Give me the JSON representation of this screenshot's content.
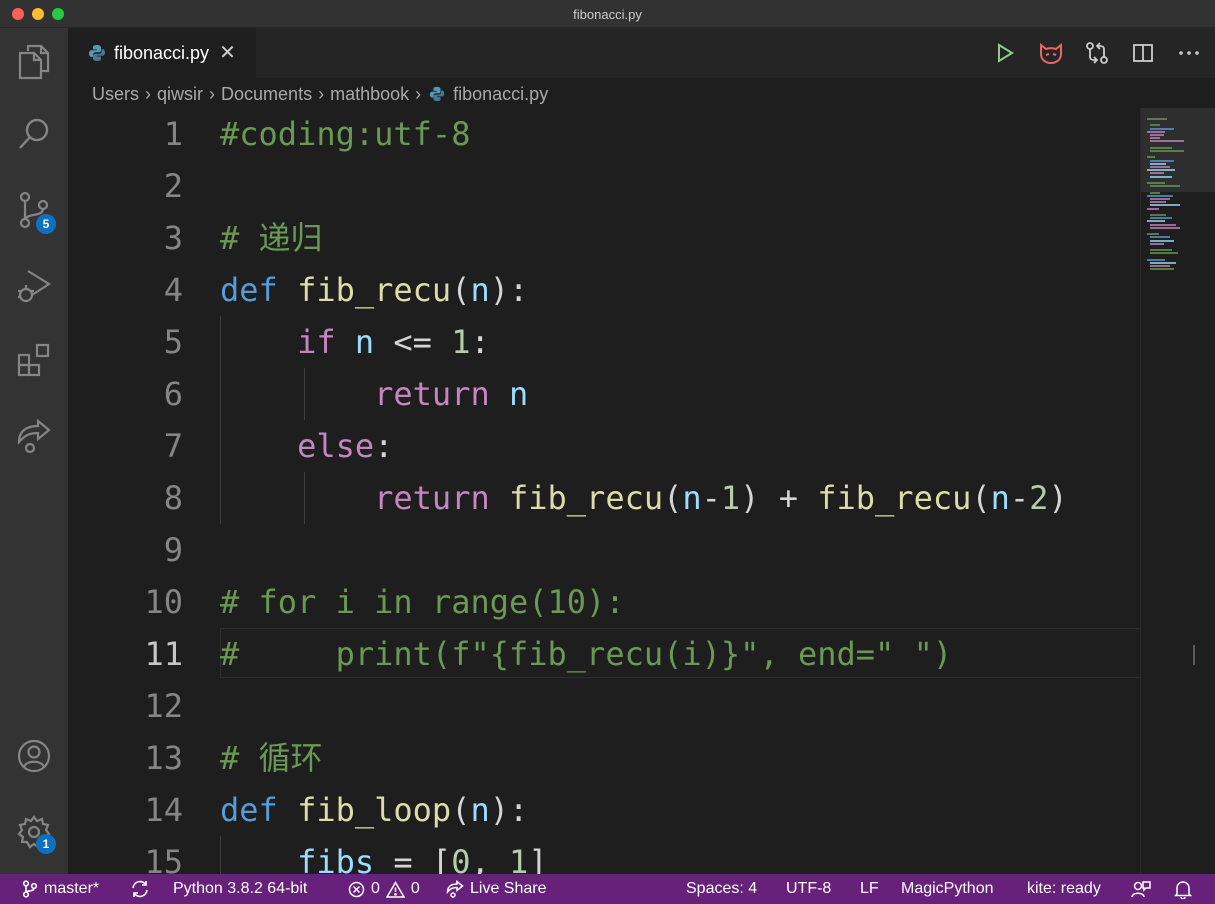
{
  "window": {
    "title": "fibonacci.py"
  },
  "activity_bar": {
    "items": [
      {
        "name": "explorer",
        "icon": "files-icon"
      },
      {
        "name": "search",
        "icon": "search-icon"
      },
      {
        "name": "source-control",
        "icon": "source-control-icon",
        "badge": "5"
      },
      {
        "name": "run-debug",
        "icon": "run-debug-icon"
      },
      {
        "name": "extensions",
        "icon": "extensions-icon"
      },
      {
        "name": "live-share",
        "icon": "live-share-icon"
      }
    ],
    "bottom": [
      {
        "name": "accounts",
        "icon": "account-icon"
      },
      {
        "name": "manage",
        "icon": "gear-icon",
        "badge": "1"
      }
    ]
  },
  "tab": {
    "label": "fibonacci.py",
    "close": "✕"
  },
  "breadcrumb": {
    "items": [
      "Users",
      "qiwsir",
      "Documents",
      "mathbook",
      "fibonacci.py"
    ]
  },
  "editor": {
    "current_line": 11,
    "lines": [
      {
        "n": "1",
        "tokens": [
          [
            "c",
            "#coding:utf-8"
          ]
        ]
      },
      {
        "n": "2",
        "tokens": []
      },
      {
        "n": "3",
        "tokens": [
          [
            "c",
            "# 递归"
          ]
        ]
      },
      {
        "n": "4",
        "tokens": [
          [
            "k",
            "def"
          ],
          [
            "o",
            " "
          ],
          [
            "f",
            "fib_recu"
          ],
          [
            "o",
            "("
          ],
          [
            "v",
            "n"
          ],
          [
            "o",
            "):"
          ]
        ]
      },
      {
        "n": "5",
        "tokens": [
          [
            "o",
            "    "
          ],
          [
            "p",
            "if"
          ],
          [
            "o",
            " "
          ],
          [
            "v",
            "n"
          ],
          [
            "o",
            " <= "
          ],
          [
            "n",
            "1"
          ],
          [
            "o",
            ":"
          ]
        ]
      },
      {
        "n": "6",
        "tokens": [
          [
            "o",
            "        "
          ],
          [
            "p",
            "return"
          ],
          [
            "o",
            " "
          ],
          [
            "v",
            "n"
          ]
        ]
      },
      {
        "n": "7",
        "tokens": [
          [
            "o",
            "    "
          ],
          [
            "p",
            "else"
          ],
          [
            "o",
            ":"
          ]
        ]
      },
      {
        "n": "8",
        "tokens": [
          [
            "o",
            "        "
          ],
          [
            "p",
            "return"
          ],
          [
            "o",
            " "
          ],
          [
            "f",
            "fib_recu"
          ],
          [
            "o",
            "("
          ],
          [
            "v",
            "n"
          ],
          [
            "o",
            "-"
          ],
          [
            "n",
            "1"
          ],
          [
            "o",
            ") + "
          ],
          [
            "f",
            "fib_recu"
          ],
          [
            "o",
            "("
          ],
          [
            "v",
            "n"
          ],
          [
            "o",
            "-"
          ],
          [
            "n",
            "2"
          ],
          [
            "o",
            ")"
          ]
        ]
      },
      {
        "n": "9",
        "tokens": []
      },
      {
        "n": "10",
        "tokens": [
          [
            "c",
            "# for i in range(10):"
          ]
        ]
      },
      {
        "n": "11",
        "tokens": [
          [
            "c",
            "#     print(f\"{fib_recu(i)}\", end=\" \")"
          ]
        ]
      },
      {
        "n": "12",
        "tokens": []
      },
      {
        "n": "13",
        "tokens": [
          [
            "c",
            "# 循环"
          ]
        ]
      },
      {
        "n": "14",
        "tokens": [
          [
            "k",
            "def"
          ],
          [
            "o",
            " "
          ],
          [
            "f",
            "fib_loop"
          ],
          [
            "o",
            "("
          ],
          [
            "v",
            "n"
          ],
          [
            "o",
            "):"
          ]
        ]
      },
      {
        "n": "15",
        "tokens": [
          [
            "o",
            "    "
          ],
          [
            "v",
            "fibs"
          ],
          [
            "o",
            " = ["
          ],
          [
            "n",
            "0"
          ],
          [
            "o",
            ", "
          ],
          [
            "n",
            "1"
          ],
          [
            "o",
            "]"
          ]
        ]
      }
    ]
  },
  "status_bar": {
    "branch": "master*",
    "interpreter": "Python 3.8.2 64-bit",
    "errors": "0",
    "warnings": "0",
    "live_share": "Live Share",
    "spaces": "Spaces: 4",
    "encoding": "UTF-8",
    "eol": "LF",
    "language": "MagicPython",
    "kite": "kite: ready"
  },
  "colors": {
    "status_bg": "#68217a",
    "activity_bg": "#333333",
    "badge": "#0e70c0"
  }
}
